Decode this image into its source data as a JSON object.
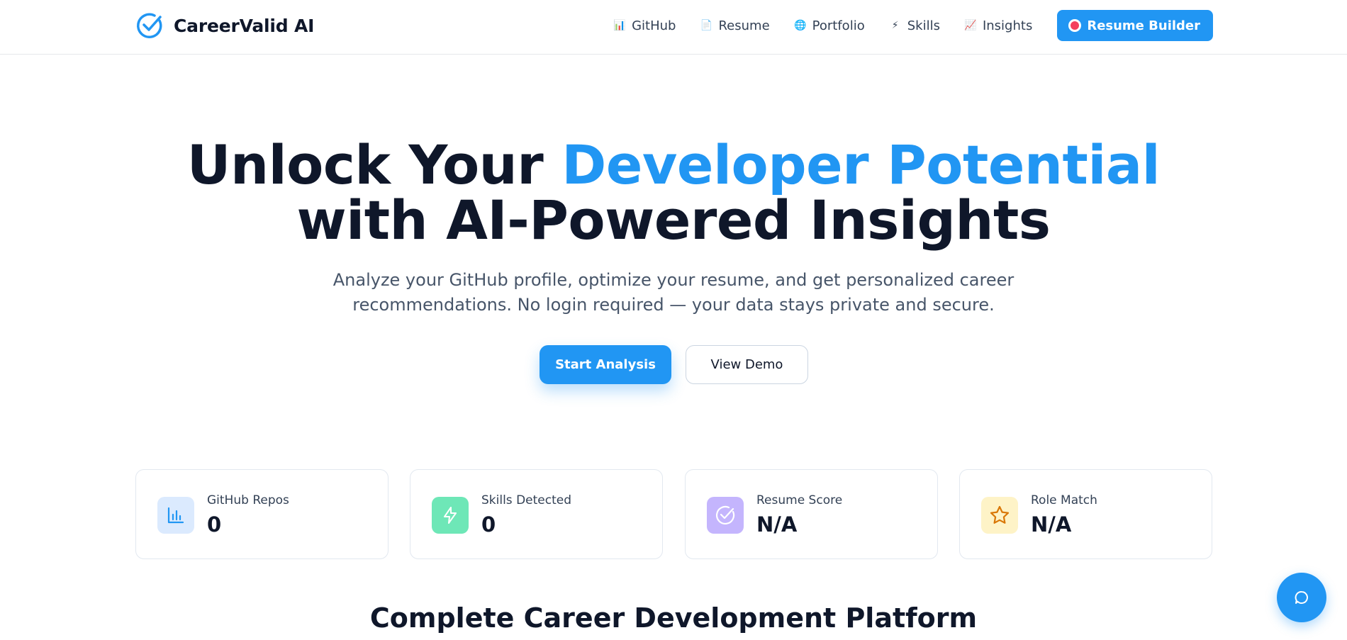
{
  "brand": {
    "name": "CareerValid AI",
    "logo_icon": "check-circle-icon",
    "accent": "#2196f3"
  },
  "nav": {
    "items": [
      {
        "label": "GitHub",
        "icon": "bar-chart-emoji",
        "glyph": "📊"
      },
      {
        "label": "Resume",
        "icon": "document-emoji",
        "glyph": "📄"
      },
      {
        "label": "Portfolio",
        "icon": "globe-emoji",
        "glyph": "🌐"
      },
      {
        "label": "Skills",
        "icon": "lightning-emoji",
        "glyph": "⚡"
      },
      {
        "label": "Insights",
        "icon": "line-chart-emoji",
        "glyph": "📈"
      }
    ],
    "cta": {
      "label": "Resume Builder",
      "icon": "target-emoji"
    }
  },
  "hero": {
    "title_part1": "Unlock Your ",
    "title_accent": "Developer Potential",
    "title_line2": "with AI-Powered Insights",
    "subtitle": "Analyze your GitHub profile, optimize your resume, and get personalized career recommendations. No login required — your data stays private and secure.",
    "primary_button": "Start Analysis",
    "secondary_button": "View Demo"
  },
  "stats": [
    {
      "label": "GitHub Repos",
      "value": "0",
      "icon": "bar-chart-icon",
      "icon_bg": "#dbeafe",
      "icon_color": "#2196f3"
    },
    {
      "label": "Skills Detected",
      "value": "0",
      "icon": "lightning-icon",
      "icon_bg": "#6ee7b7",
      "icon_color": "#ffffff"
    },
    {
      "label": "Resume Score",
      "value": "N/A",
      "icon": "check-circle-icon",
      "icon_bg": "#c4b5fd",
      "icon_color": "#ffffff"
    },
    {
      "label": "Role Match",
      "value": "N/A",
      "icon": "star-icon",
      "icon_bg": "#fef3c7",
      "icon_color": "#d97706"
    }
  ],
  "section": {
    "title": "Complete Career Development Platform"
  },
  "chat": {
    "icon": "chat-bubble-icon"
  }
}
